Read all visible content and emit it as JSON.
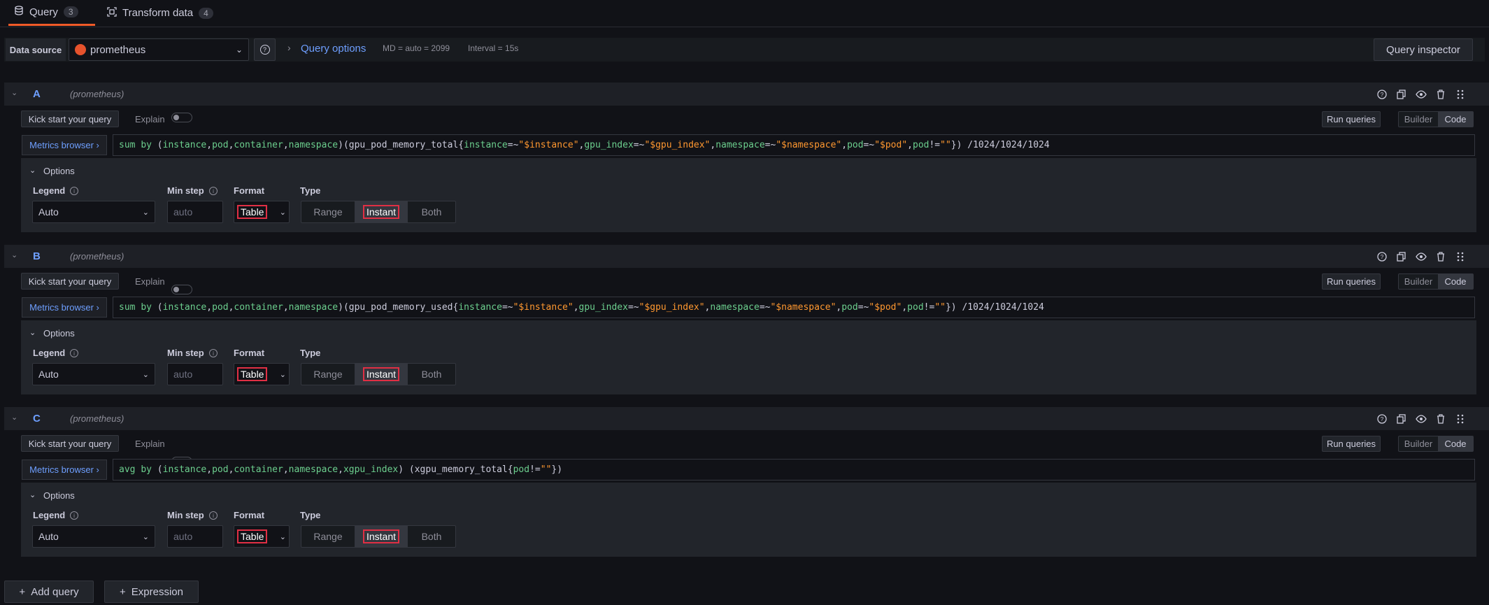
{
  "tabs": [
    {
      "label": "Query",
      "count": "3"
    },
    {
      "label": "Transform data",
      "count": "4"
    }
  ],
  "toolbar": {
    "data_source_label": "Data source",
    "data_source_value": "prometheus",
    "query_options_label": "Query options",
    "md_text": "MD = auto = 2099",
    "interval_text": "Interval = 15s",
    "query_inspector_label": "Query inspector"
  },
  "common": {
    "kick_start": "Kick start your query",
    "explain": "Explain",
    "run_queries": "Run queries",
    "builder": "Builder",
    "code": "Code",
    "metrics_browser": "Metrics browser ›",
    "options": "Options",
    "legend_label": "Legend",
    "legend_value": "Auto",
    "min_step_label": "Min step",
    "min_step_placeholder": "auto",
    "format_label": "Format",
    "format_value": "Table",
    "type_label": "Type",
    "type_range": "Range",
    "type_instant": "Instant",
    "type_both": "Both"
  },
  "queries": [
    {
      "letter": "A",
      "source": "(prometheus)",
      "expr": "sum by (instance,pod,container,namespace)(gpu_pod_memory_total{instance=~\"$instance\",gpu_index=~\"$gpu_index\",namespace=~\"$namespace\",pod=~\"$pod\",pod!=\"\"}) /1024/1024/1024"
    },
    {
      "letter": "B",
      "source": "(prometheus)",
      "expr": "sum by (instance,pod,container,namespace)(gpu_pod_memory_used{instance=~\"$instance\",gpu_index=~\"$gpu_index\",namespace=~\"$namespace\",pod=~\"$pod\",pod!=\"\"}) /1024/1024/1024"
    },
    {
      "letter": "C",
      "source": "(prometheus)",
      "expr": "avg by (instance,pod,container,namespace,xgpu_index) (xgpu_memory_total{pod!=\"\"})"
    }
  ],
  "footer": {
    "add_query": "Add query",
    "expression": "Expression"
  },
  "colors": {
    "accent": "#f05a28",
    "link": "#6e9fff",
    "highlight": "#e02f44"
  }
}
